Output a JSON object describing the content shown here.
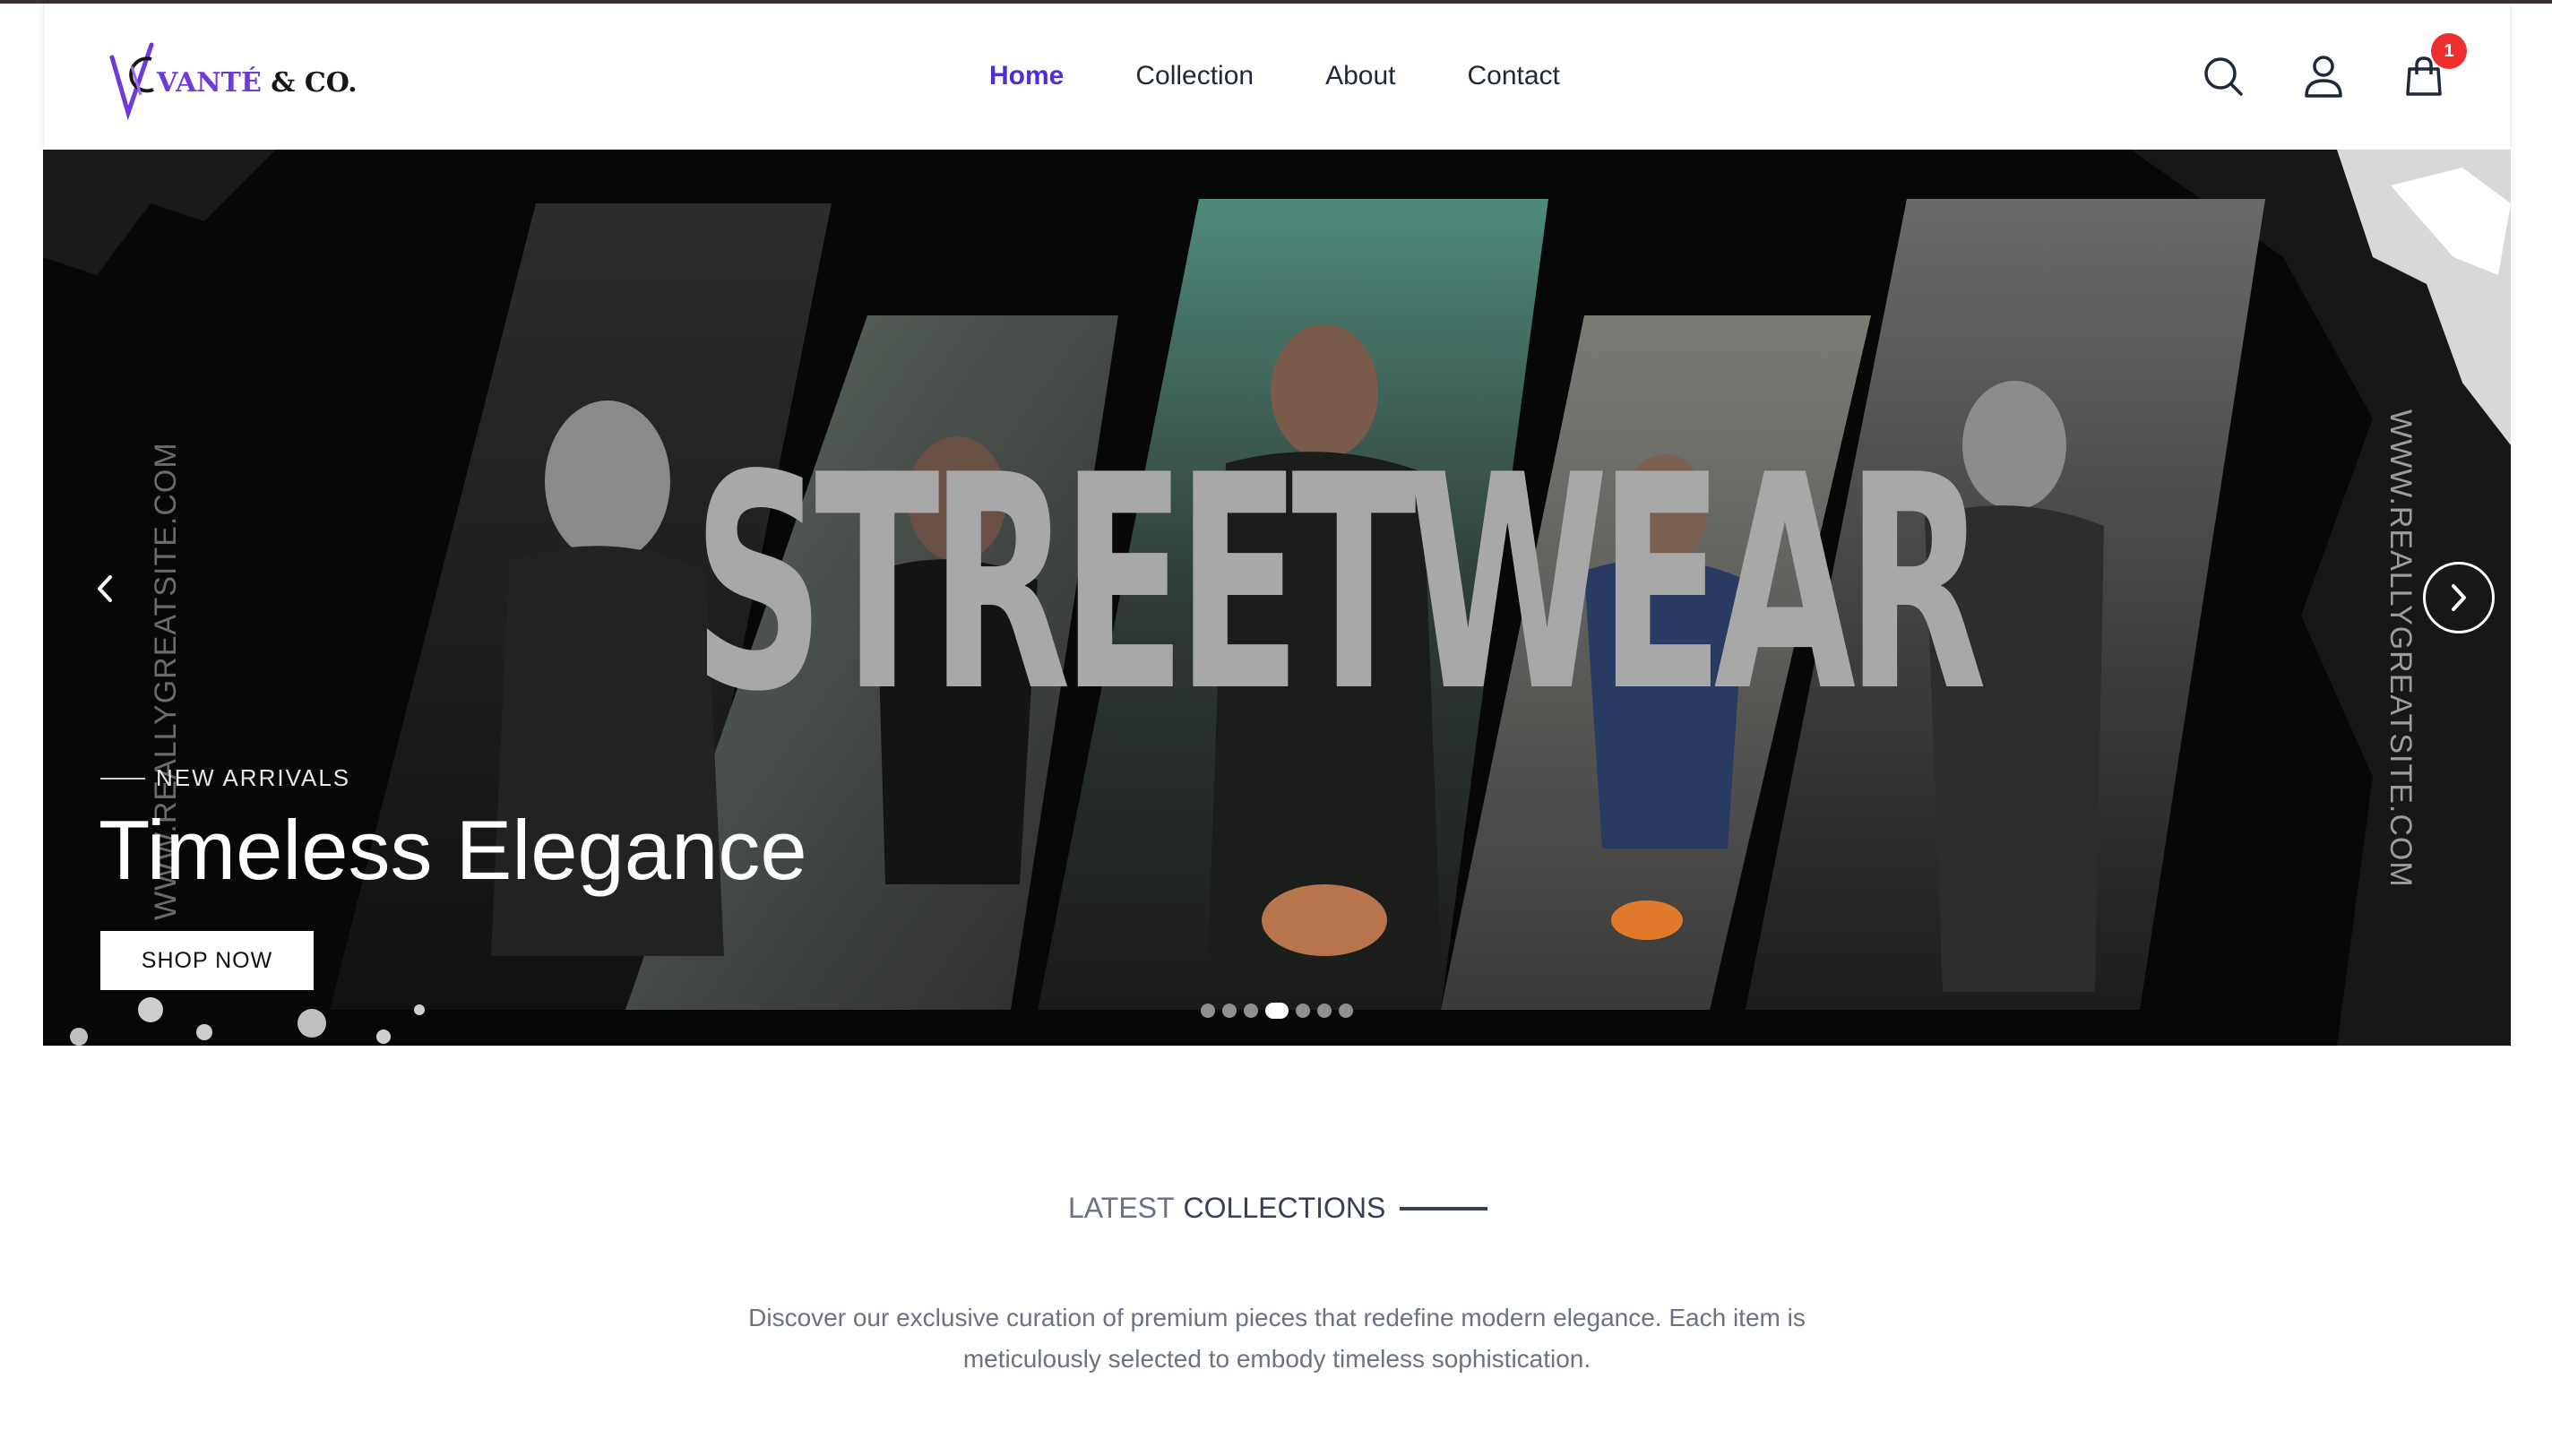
{
  "brand": {
    "name_accent": "VANTÉ",
    "name_rest": " & CO.",
    "logo_icon": "v-monogram-logo",
    "accent_color": "#6d3bd8"
  },
  "nav": {
    "links": [
      {
        "label": "Home",
        "active": true
      },
      {
        "label": "Collection",
        "active": false
      },
      {
        "label": "About",
        "active": false
      },
      {
        "label": "Contact",
        "active": false
      }
    ],
    "active_color": "#4f2fd1",
    "icons": [
      "search-icon",
      "user-icon",
      "shopping-bag-icon"
    ],
    "cart_count": "1",
    "badge_color": "#ef2f2f"
  },
  "hero": {
    "banner_word": "STREETWEAR",
    "vertical_text": "WWW.REALLYGREATSITE.COM",
    "eyebrow": "NEW ARRIVALS",
    "title": "Timeless Elegance",
    "cta_label": "SHOP NOW",
    "slide_count": 7,
    "active_slide": 4,
    "prev_icon": "chevron-left-icon",
    "next_icon": "chevron-right-icon"
  },
  "collections": {
    "heading_pre": "LATEST",
    "heading_main": "COLLECTIONS",
    "description": "Discover our exclusive curation of premium pieces that redefine modern elegance. Each item is meticulously selected to embody timeless sophistication."
  }
}
